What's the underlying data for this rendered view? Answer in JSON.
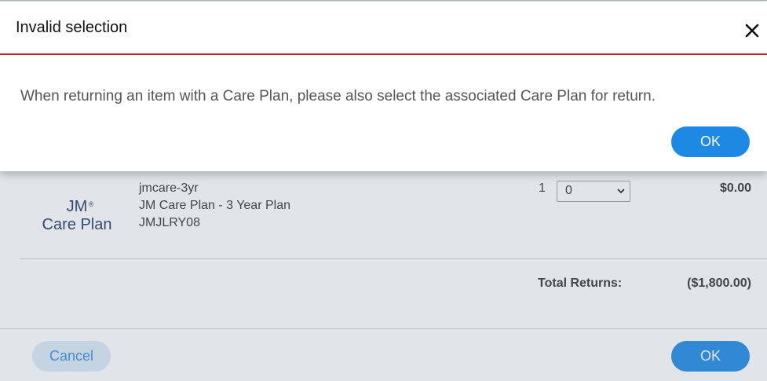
{
  "modal": {
    "title": "Invalid selection",
    "message": "When returning an item with a Care Plan, please also select the associated Care Plan for return.",
    "ok_label": "OK",
    "close_icon": "close-icon"
  },
  "item": {
    "logo_top": "JM",
    "logo_reg": "®",
    "logo_bottom": "Care Plan",
    "sku": "jmcare-3yr",
    "name": "JM Care Plan - 3 Year Plan",
    "code": "JMJLRY08",
    "quantity": "1",
    "return_qty_selected": "0",
    "price": "$0.00"
  },
  "totals": {
    "label": "Total Returns:",
    "value": "($1,800.00)"
  },
  "footer": {
    "cancel_label": "Cancel",
    "ok_label": "OK"
  },
  "colors": {
    "accent": "#1e88e5",
    "error_rule": "#c62828",
    "logo": "#1f3a64"
  }
}
